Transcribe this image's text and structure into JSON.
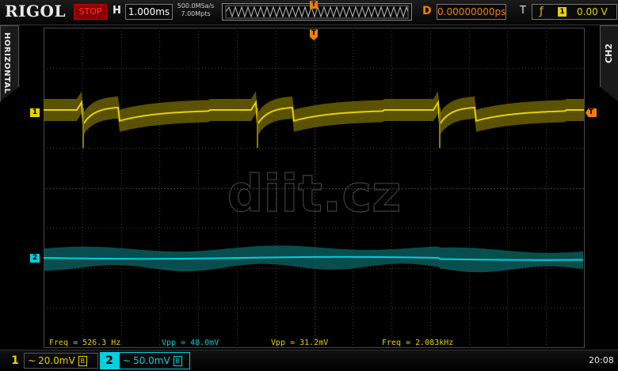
{
  "header": {
    "brand": "RIGOL",
    "run_state": "STOP",
    "horizontal_label": "H",
    "timebase": "1.000ms",
    "sample_rate": "500.0MSa/s",
    "memory_depth": "7.00Mpts",
    "trigger_position_marker": "T",
    "delay_label": "D",
    "delay_value": "0.00000000ps",
    "trigger_label": "T",
    "trigger_edge_icon": "rising-edge-icon",
    "trigger_source": "1",
    "trigger_level": "0.00 V"
  },
  "side_tabs": {
    "left": "HORIZONTAL",
    "right": "CH2"
  },
  "markers": {
    "ch1": "1",
    "ch2": "2",
    "trigger_level": "T",
    "trigger_time": "T"
  },
  "watermark": "diit.cz",
  "measurements": [
    {
      "label": "Freq",
      "value": "526.3 Hz",
      "text": "Freq = 526.3 Hz"
    },
    {
      "label": "Vpp",
      "value": "48.0mV",
      "text": "Vpp = 48.0mV"
    },
    {
      "label": "Vpp",
      "value": "31.2mV",
      "text": "Vpp = 31.2mV"
    },
    {
      "label": "Freq",
      "value": "2.083kHz",
      "text": "Freq = 2.083kHz"
    }
  ],
  "channels": [
    {
      "number": "1",
      "coupling_icon": "ac-coupling-icon",
      "scale": "20.0mV",
      "bw_limit_icon": "bandwidth-limit-icon",
      "color": "#e8d000"
    },
    {
      "number": "2",
      "coupling_icon": "ac-coupling-icon",
      "scale": "50.0mV",
      "bw_limit_icon": "bandwidth-limit-icon",
      "color": "#00d0e0"
    }
  ],
  "clock": "20:08",
  "colors": {
    "ch1": "#e8d000",
    "ch2": "#00d0e0",
    "trigger": "#f08000",
    "stop": "#ff3a3a"
  }
}
